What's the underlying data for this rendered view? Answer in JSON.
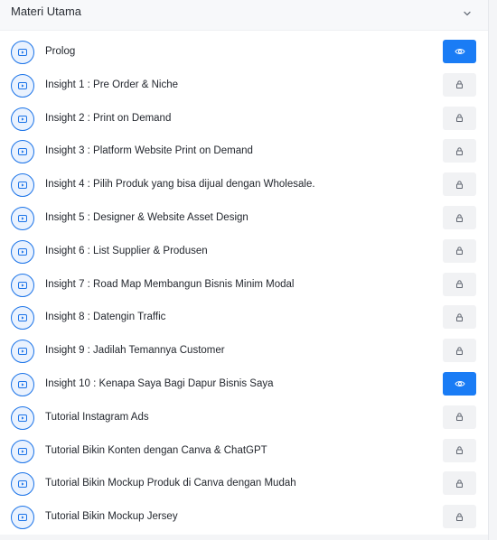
{
  "section": {
    "title": "Materi Utama",
    "toggle_icon": "chevron-down-icon"
  },
  "colors": {
    "accent": "#1a7cf5",
    "locked_bg": "#f1f2f4"
  },
  "lessons": [
    {
      "title": "Prolog",
      "state": "open"
    },
    {
      "title": "Insight 1 : Pre Order & Niche",
      "state": "locked"
    },
    {
      "title": "Insight 2 : Print on Demand",
      "state": "locked"
    },
    {
      "title": "Insight 3 : Platform Website Print on Demand",
      "state": "locked"
    },
    {
      "title": "Insight 4 : Pilih Produk yang bisa dijual dengan Wholesale.",
      "state": "locked"
    },
    {
      "title": "Insight 5 : Designer & Website Asset Design",
      "state": "locked"
    },
    {
      "title": "Insight 6 : List Supplier & Produsen",
      "state": "locked"
    },
    {
      "title": "Insight 7 : Road Map Membangun Bisnis Minim Modal",
      "state": "locked"
    },
    {
      "title": "Insight 8 : Datengin Traffic",
      "state": "locked"
    },
    {
      "title": "Insight 9 : Jadilah Temannya Customer",
      "state": "locked"
    },
    {
      "title": "Insight 10 : Kenapa Saya Bagi Dapur Bisnis Saya",
      "state": "open"
    },
    {
      "title": "Tutorial Instagram Ads",
      "state": "locked"
    },
    {
      "title": "Tutorial Bikin Konten dengan Canva & ChatGPT",
      "state": "locked"
    },
    {
      "title": "Tutorial Bikin Mockup Produk di Canva dengan Mudah",
      "state": "locked"
    },
    {
      "title": "Tutorial Bikin Mockup Jersey",
      "state": "locked"
    }
  ]
}
